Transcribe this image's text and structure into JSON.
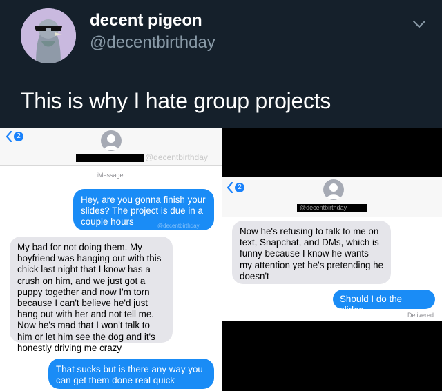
{
  "tweet": {
    "display_name": "decent pigeon",
    "handle": "@decentbirthday",
    "text": "This is why I hate group projects"
  },
  "left_screenshot": {
    "back_badge": "2",
    "watermark": "@decentbirthday",
    "label": "iMessage",
    "messages": [
      {
        "from": "me",
        "text": "Hey, are you gonna finish your slides? The project is due in a couple hours",
        "watermark": "@decentbirthday"
      },
      {
        "from": "them",
        "text": "My bad for not doing them. My boyfriend was hanging out with this chick last night that I know has a crush on him, and we just got a puppy together and now I'm torn because I can't believe he'd just hang out with her and not tell me. Now he's mad that I won't talk to him or let him see the dog and it's honestly driving me crazy"
      },
      {
        "from": "me",
        "text": "That sucks but is there any way you can get them done real quick"
      }
    ]
  },
  "right_screenshot": {
    "back_badge": "2",
    "redact_watermark": "@decentbirthday",
    "messages": [
      {
        "from": "them",
        "text": "Now he's refusing to talk to me on text, Snapchat, and DMs, which is funny because I know he wants my attention yet he's pretending he doesn't"
      },
      {
        "from": "me",
        "text": "Should I do the slides"
      }
    ],
    "status": "Delivered"
  },
  "colors": {
    "tweet_bg": "#15202b",
    "imessage_blue": "#1a8cf6",
    "grey_bubble": "#e5e5ea"
  }
}
